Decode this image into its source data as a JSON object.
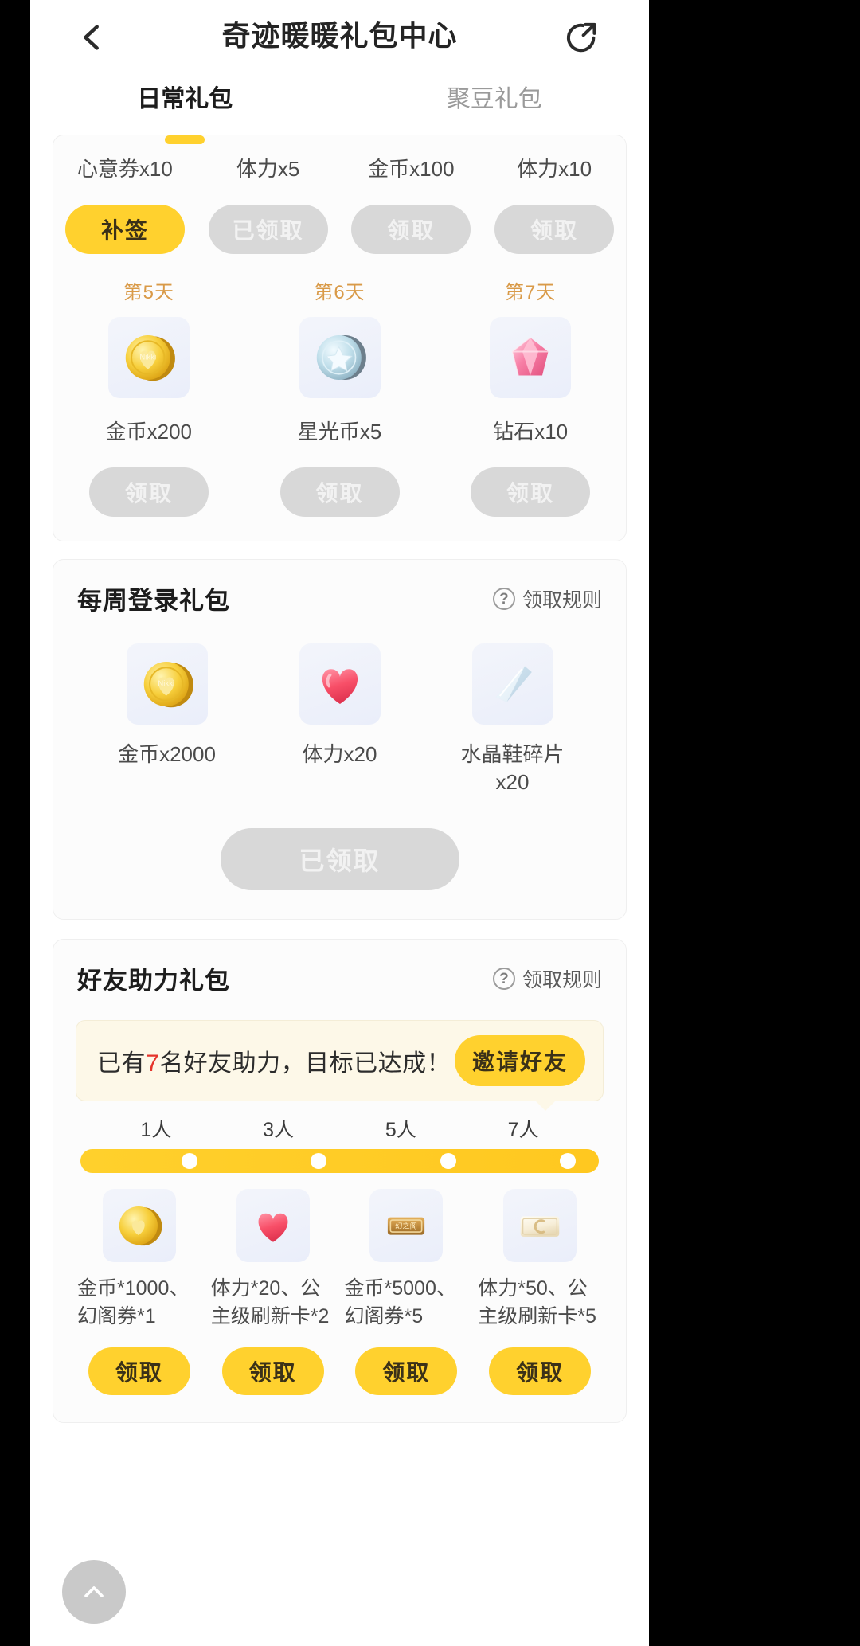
{
  "header": {
    "title": "奇迹暖暖礼包中心",
    "back_icon": "arrow-left-icon",
    "share_icon": "share-icon"
  },
  "tabs": [
    {
      "label": "日常礼包",
      "active": true
    },
    {
      "label": "聚豆礼包",
      "active": false
    }
  ],
  "signin": {
    "top_row": [
      {
        "name": "心意券x10",
        "button": "补签",
        "state": "makeup"
      },
      {
        "name": "体力x5",
        "button": "已领取",
        "state": "claimed"
      },
      {
        "name": "金币x100",
        "button": "领取",
        "state": "disabled"
      },
      {
        "name": "体力x10",
        "button": "领取",
        "state": "disabled"
      }
    ],
    "bottom_row": [
      {
        "day": "第5天",
        "icon": "gold-coin-icon",
        "name": "金币x200",
        "button": "领取"
      },
      {
        "day": "第6天",
        "icon": "star-coin-icon",
        "name": "星光币x5",
        "button": "领取"
      },
      {
        "day": "第7天",
        "icon": "diamond-icon",
        "name": "钻石x10",
        "button": "领取"
      }
    ]
  },
  "weekly": {
    "title": "每周登录礼包",
    "rules_label": "领取规则",
    "rules_icon": "question-mark-icon",
    "items": [
      {
        "icon": "gold-coin-icon",
        "name": "金币x2000"
      },
      {
        "icon": "heart-icon",
        "name": "体力x20"
      },
      {
        "icon": "crystal-shoe-icon",
        "name": "水晶鞋碎片\nx20"
      }
    ],
    "button": "已领取"
  },
  "friends": {
    "title": "好友助力礼包",
    "rules_label": "领取规则",
    "rules_icon": "question-mark-icon",
    "bubble_prefix": "已有",
    "bubble_count": "7",
    "bubble_suffix": "名好友助力，目标已达成！",
    "invite_button": "邀请好友",
    "milestones": [
      "1人",
      "3人",
      "5人",
      "7人"
    ],
    "progress_percent": 100,
    "rewards": [
      {
        "icon": "gold-coin-icon",
        "name": "金币*1000、幻阁券*1",
        "button": "领取"
      },
      {
        "icon": "heart-icon",
        "name": "体力*20、公主级刷新卡*2",
        "button": "领取"
      },
      {
        "icon": "gold-bar-icon",
        "name": "金币*5000、幻阁券*5",
        "button": "领取"
      },
      {
        "icon": "card-icon",
        "name": "体力*50、公主级刷新卡*5",
        "button": "领取"
      }
    ]
  },
  "fab": {
    "icon": "chevron-up-icon"
  },
  "colors": {
    "accent": "#ffd12e",
    "disabled": "#d8d8d8",
    "day_label": "#d99a48",
    "highlight": "#e5342b",
    "bubble_bg": "#fdf8e8"
  }
}
